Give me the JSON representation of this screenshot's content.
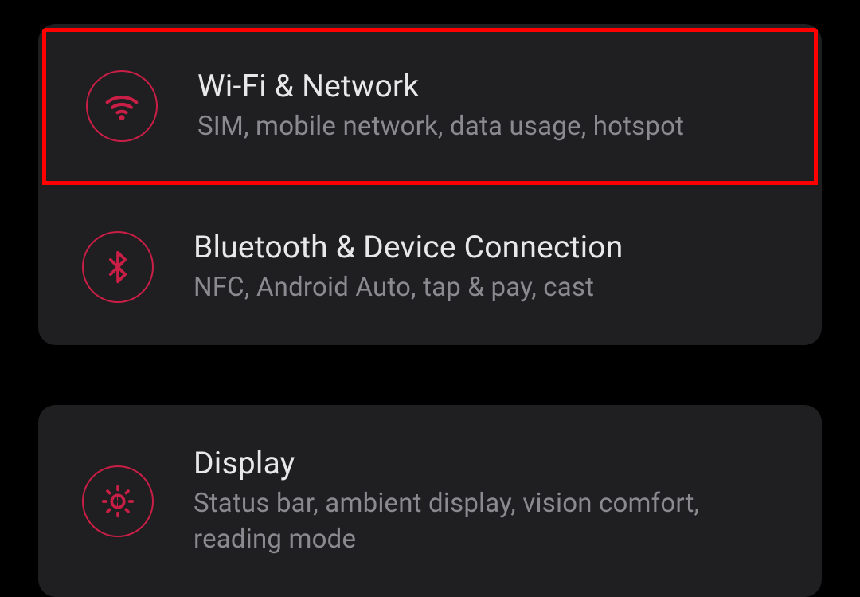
{
  "colors": {
    "accent": "#c91e45",
    "highlight_border": "#ff0000",
    "card_bg": "#1f1f22",
    "title_text": "#e8e8e8",
    "subtitle_text": "#8a8a8f"
  },
  "groups": [
    {
      "items": [
        {
          "id": "wifi-network",
          "icon": "wifi-icon",
          "title": "Wi-Fi & Network",
          "subtitle": "SIM, mobile network, data usage, hotspot",
          "highlighted": true
        },
        {
          "id": "bluetooth-device",
          "icon": "bluetooth-icon",
          "title": "Bluetooth & Device Connection",
          "subtitle": "NFC, Android Auto, tap & pay, cast",
          "highlighted": false
        }
      ]
    },
    {
      "items": [
        {
          "id": "display",
          "icon": "brightness-icon",
          "title": "Display",
          "subtitle": "Status bar, ambient display, vision comfort, reading mode",
          "highlighted": false
        }
      ]
    }
  ]
}
